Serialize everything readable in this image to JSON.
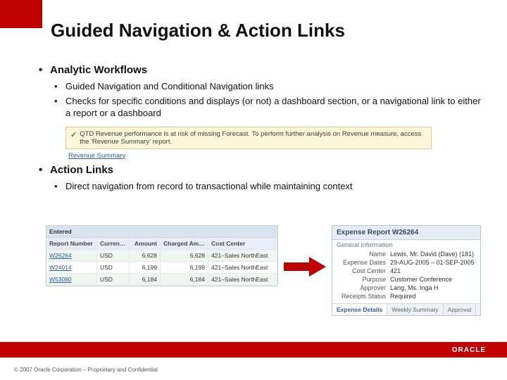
{
  "slide": {
    "title": "Guided Navigation & Action Links",
    "section1": {
      "heading": "Analytic Workflows",
      "b1": "Guided Navigation and Conditional Navigation links",
      "b2": "Checks for specific conditions and displays (or not) a dashboard section, or a navigational link to either a report or a dashboard"
    },
    "alert": {
      "text": "QTD Revenue performance is at risk of missing Forecast. To perform further analysis on Revenue measure, access the 'Revenue Summary' report.",
      "link": "Revenue Summary"
    },
    "section2": {
      "heading": "Action Links",
      "b1": "Direct navigation from record to transactional while maintaining context"
    },
    "table": {
      "supra": "Entered",
      "headers": [
        "Report Number",
        "Currency",
        "Amount",
        "Charged Amount",
        "Cost Center"
      ],
      "rows": [
        {
          "rn": "W26264",
          "cur": "USD",
          "amt": "6,628",
          "camt": "6,628",
          "cc": "421–Sales NorthEast"
        },
        {
          "rn": "W24014",
          "cur": "USD",
          "amt": "6,199",
          "camt": "6,199",
          "cc": "421–Sales NorthEast"
        },
        {
          "rn": "W53080",
          "cur": "USD",
          "amt": "6,184",
          "camt": "6,184",
          "cc": "421–Sales NorthEast"
        }
      ]
    },
    "detail": {
      "title": "Expense Report W26264",
      "subheader": "General Information",
      "fields": [
        {
          "k": "Name",
          "v": "Lewis, Mr. David (Dave) (181)"
        },
        {
          "k": "Expense Dates",
          "v": "29-AUG-2005 – 01-SEP-2005"
        },
        {
          "k": "Cost Center",
          "v": "421"
        },
        {
          "k": "Purpose",
          "v": "Customer Conference"
        },
        {
          "k": "Approver",
          "v": "Lang, Ms. Inga H"
        },
        {
          "k": "Receipts Status",
          "v": "Required"
        }
      ],
      "tabs": [
        "Expense Details",
        "Weekly Summary",
        "Approval"
      ]
    },
    "logo": "ORACLE",
    "footer": "© 2007 Oracle Corporation – Proprietary and Confidential"
  }
}
